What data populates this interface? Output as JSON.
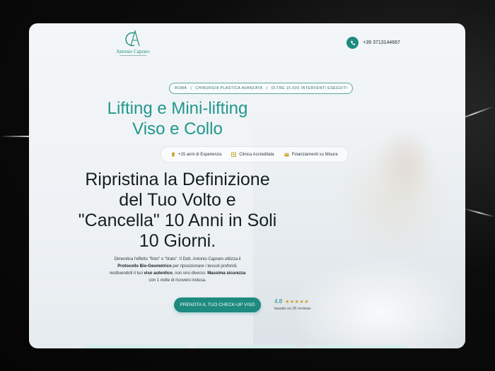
{
  "logo": {
    "monogram": "CA",
    "name": "Antonio Capraro"
  },
  "header": {
    "phone": "+39 3713144667"
  },
  "badge": {
    "items": [
      "ROMA",
      "CHIRURGIA PLASTICA AVANZATA",
      "OLTRE 15.000 INTERVENTI ESEGUITI"
    ]
  },
  "headline": {
    "line1": "Lifting e Mini-lifting",
    "line2": "Viso e Collo"
  },
  "features": [
    {
      "icon": "award-icon",
      "label": "+15 anni di Esperienza"
    },
    {
      "icon": "clinic-icon",
      "label": "Clinica Accreditata"
    },
    {
      "icon": "card-icon",
      "label": "Finanziamenti su Misura"
    }
  ],
  "hero": {
    "line1": "Ripristina la Definizione",
    "line2": "del Tuo Volto e",
    "line3": "\"Cancella\" 10 Anni in Soli",
    "line4": "10 Giorni."
  },
  "description": {
    "t1": "Dimentica l'effetto \"finto\" o \"tirato\". Il Dott. Antonio Capraro utilizza il",
    "b1": "Protocollo Bio-Geometrico",
    "t2": " per riposizionare i tessuti profondi,",
    "t3": "restituendoti il tuo ",
    "b2": "viso autentico",
    "t4": ", non uno diverso. ",
    "b3": "Massima sicurezza",
    "t5": "con 1 notte di ricovero inclusa."
  },
  "cta": {
    "label": "PRENOTA IL TUO CHECK-UP VISO"
  },
  "rating": {
    "score": "4.8",
    "stars": "★★★★★",
    "reviews": "basato su 25 reviews"
  },
  "colors": {
    "brand": "#1e8a80",
    "headline": "#22978c",
    "star": "#c9a227"
  }
}
